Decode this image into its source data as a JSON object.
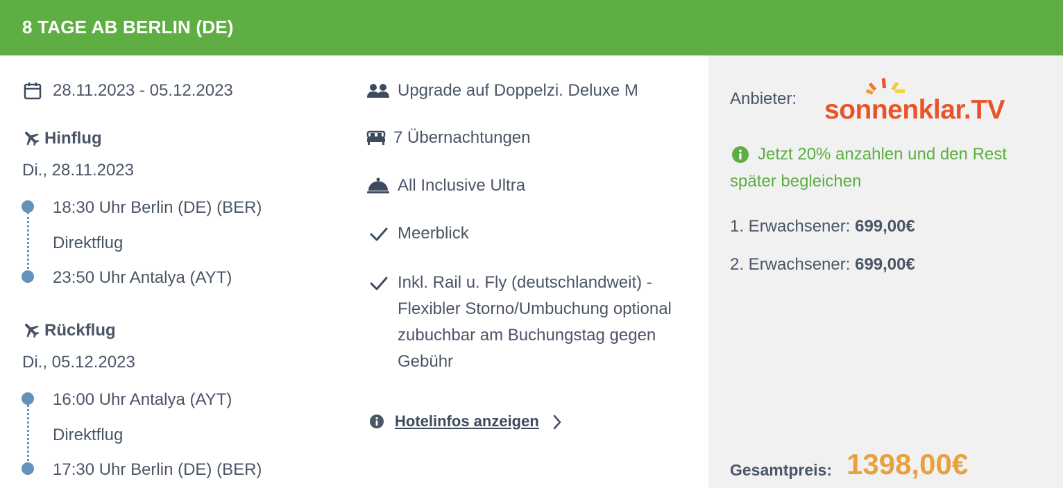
{
  "header": {
    "title": "8 TAGE AB BERLIN (DE)"
  },
  "dates": {
    "range": "28.11.2023 - 05.12.2023"
  },
  "outbound": {
    "heading": "Hinflug",
    "date": "Di., 28.11.2023",
    "departure": "18:30 Uhr Berlin (DE) (BER)",
    "type": "Direktflug",
    "arrival": "23:50 Uhr Antalya (AYT)"
  },
  "return": {
    "heading": "Rückflug",
    "date": "Di., 05.12.2023",
    "departure": "16:00 Uhr Antalya (AYT)",
    "type": "Direktflug",
    "arrival": "17:30 Uhr Berlin (DE) (BER)"
  },
  "features": {
    "room": "Upgrade auf Doppelzi. Deluxe M",
    "nights": "7 Übernachtungen",
    "board": "All Inclusive Ultra",
    "view": "Meerblick",
    "extra": "Inkl. Rail u. Fly (deutschlandweit) - Flexibler Storno/Umbuchung optional zubuchbar am Buchungstag gegen Gebühr"
  },
  "hotel_link": "Hotelinfos anzeigen",
  "sidebar": {
    "provider_label": "Anbieter:",
    "provider_logo_text": "sonnenklar.TV",
    "deposit_note": "Jetzt 20% anzahlen und den Rest später begleichen",
    "adult1_label": "1. Erwachsener:",
    "adult1_price": "699,00€",
    "adult2_label": "2. Erwachsener:",
    "adult2_price": "699,00€",
    "total_label": "Gesamtpreis:",
    "total_price": "1398,00€"
  },
  "colors": {
    "header": "#5eae43",
    "accent_green": "#5eae43",
    "price_orange": "#e8a13f",
    "timeline_blue": "#6492bd",
    "logo_orange": "#e8542a"
  },
  "icons": [
    "calendar-icon",
    "plane-icon",
    "people-icon",
    "bed-icon",
    "cloche-icon",
    "check-icon",
    "info-icon",
    "chevron-right-icon"
  ]
}
